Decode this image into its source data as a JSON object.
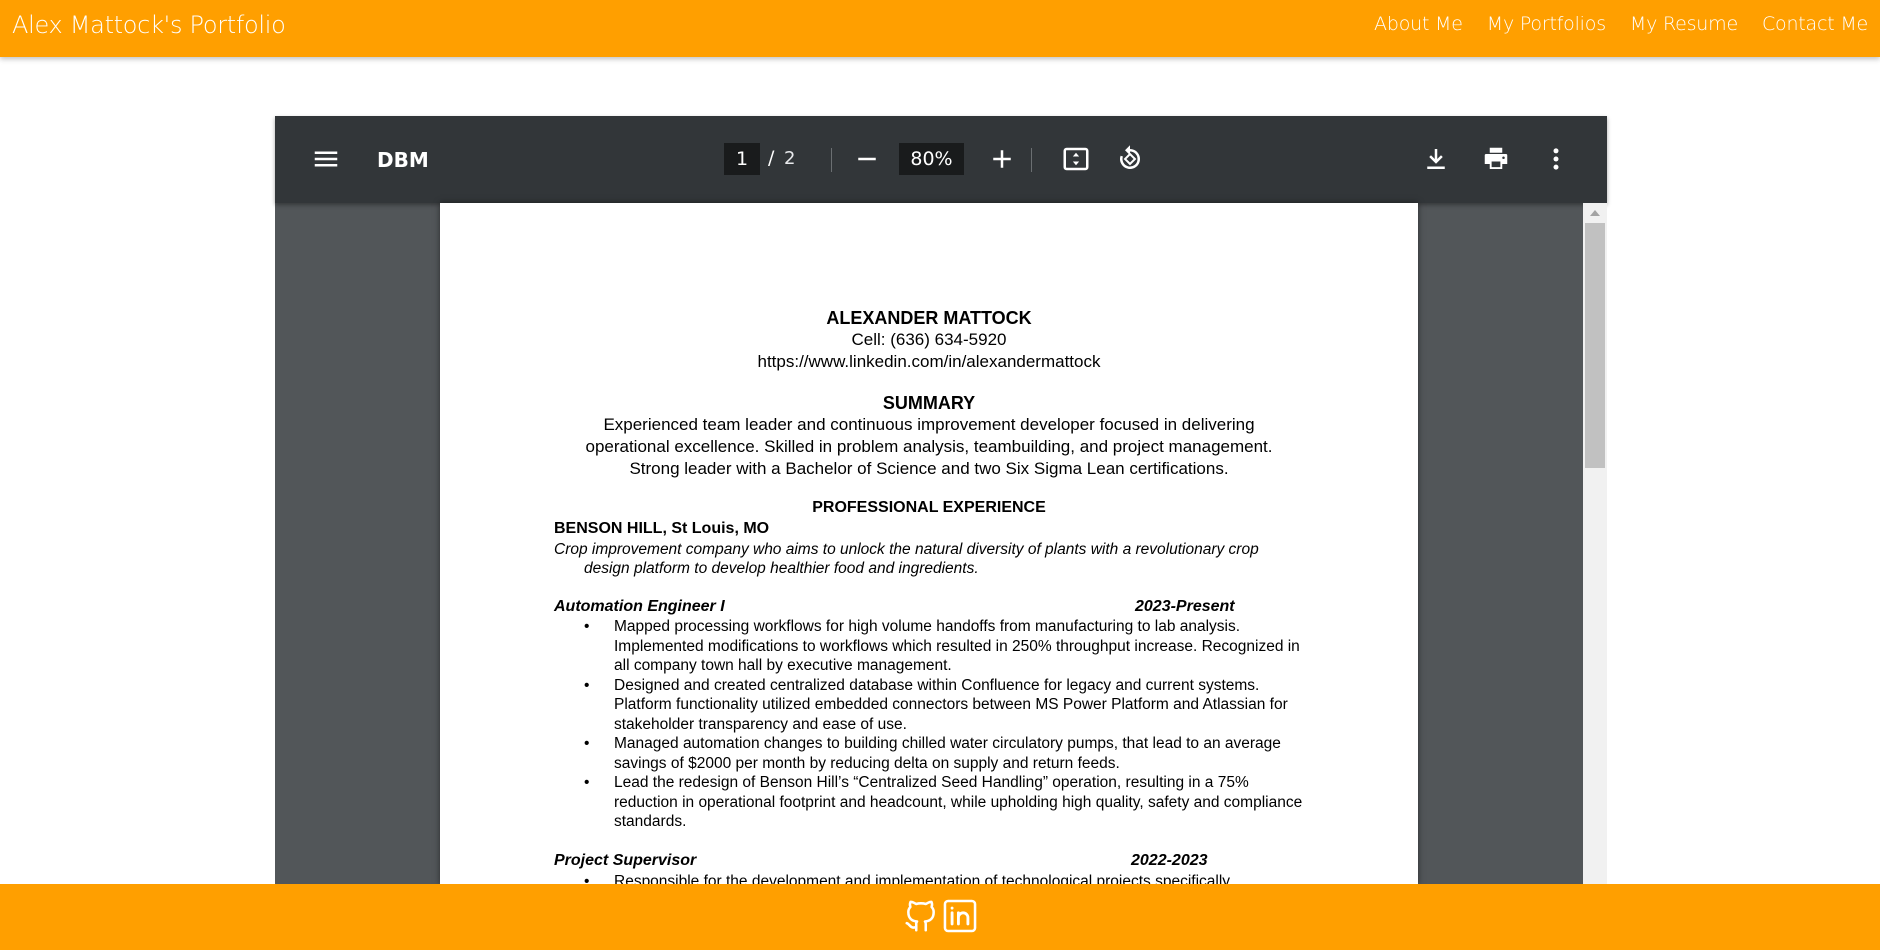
{
  "navbar": {
    "brand": "Alex Mattock's Portfolio",
    "links": [
      "About Me",
      "My Portfolios",
      "My Resume",
      "Contact Me"
    ]
  },
  "pdf_viewer": {
    "title": "DBM",
    "current_page": "1",
    "page_separator": "/",
    "total_pages": "2",
    "zoom": "80%",
    "icons": [
      "menu-icon",
      "zoom-out-icon",
      "zoom-in-icon",
      "fit-page-icon",
      "rotate-icon",
      "download-icon",
      "print-icon",
      "more-options-icon"
    ]
  },
  "resume": {
    "name": "ALEXANDER MATTOCK",
    "cell": "Cell: (636) 634-5920",
    "linkedin": "https://www.linkedin.com/in/alexandermattock",
    "summary_heading": "SUMMARY",
    "summary_lines": [
      "Experienced team leader and continuous improvement developer focused in delivering",
      "operational excellence. Skilled in problem analysis, teambuilding, and project management.",
      "Strong leader with a Bachelor of Science and two Six Sigma Lean certifications."
    ],
    "experience_heading": "PROFESSIONAL EXPERIENCE",
    "company": "BENSON HILL, St Louis, MO",
    "company_desc_1": "Crop improvement company who aims to unlock the natural diversity of plants with a revolutionary crop",
    "company_desc_2": "design platform to develop healthier food and ingredients.",
    "role_1": "Automation Engineer I",
    "role_1_dates": "2023-Present",
    "role_1_bullets": [
      "Mapped processing workflows for high volume handoffs from manufacturing to lab analysis. Implemented modifications to workflows which resulted in 250% throughput increase. Recognized in all company town hall by executive management.",
      "Designed and created centralized database within Confluence for legacy and current systems. Platform functionality utilized embedded connectors between MS Power Platform and Atlassian for stakeholder transparency and ease of use.",
      "Managed automation changes to building chilled water circulatory pumps, that lead to an average savings of $2000 per month by reducing delta on supply and return feeds.",
      "Lead the redesign of Benson Hill’s “Centralized Seed Handling” operation, resulting in a 75% reduction in operational footprint and headcount, while upholding high quality, safety and compliance standards."
    ],
    "role_2": "Project Supervisor",
    "role_2_dates": "2022-2023",
    "role_2_bullet_partial": "Responsible for the development and implementation of technological projects specifically"
  },
  "footer": {
    "icons": [
      "github-icon",
      "linkedin-icon"
    ]
  },
  "colors": {
    "accent": "#ff9f00",
    "toolbar": "#323639",
    "viewer_bg": "#525659"
  }
}
